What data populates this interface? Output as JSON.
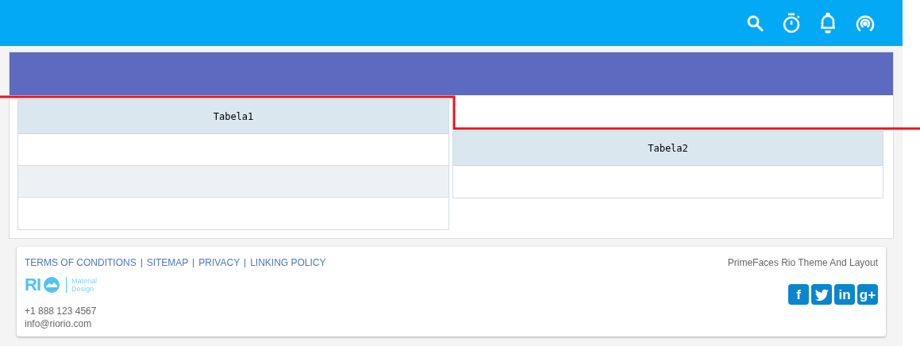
{
  "topbar": {
    "icons": [
      {
        "kind": "search"
      },
      {
        "kind": "stopwatch"
      },
      {
        "kind": "bell"
      },
      {
        "kind": "broadcast"
      }
    ]
  },
  "tables": [
    {
      "header": "Tabela1",
      "rows": [
        {
          "kind": "plain"
        },
        {
          "kind": "striped"
        },
        {
          "kind": "plain"
        }
      ]
    },
    {
      "header": "Tabela2",
      "rows": [
        {
          "kind": "plain"
        }
      ]
    }
  ],
  "footer": {
    "links": [
      "TERMS OF CONDITIONS",
      "SITEMAP",
      "PRIVACY",
      "LINKING POLICY"
    ],
    "logo": {
      "text": "RI",
      "tagline_1": "Material",
      "tagline_2": "Design"
    },
    "phone": "+1 888 123 4567",
    "email": "info@riorio.com",
    "credit": "PrimeFaces Rio Theme And Layout",
    "social": [
      {
        "kind": "facebook",
        "label": "f"
      },
      {
        "kind": "twitter"
      },
      {
        "kind": "linkedin",
        "label": "in"
      },
      {
        "kind": "googleplus",
        "label": "g+"
      }
    ]
  }
}
